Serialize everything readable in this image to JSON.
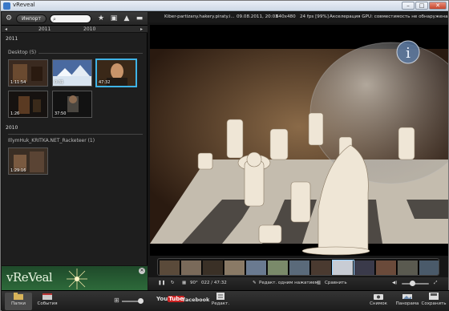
{
  "window": {
    "title": "vReveal",
    "buttons": [
      "–",
      "□",
      "✕"
    ]
  },
  "left_toolbar": {
    "import_label": "Импорт",
    "search_placeholder": ""
  },
  "timeline": {
    "prev": "◂",
    "years": [
      "2011",
      "2010"
    ],
    "next": "▸"
  },
  "library": {
    "year_2011": "2011",
    "folder1": {
      "name": "Desktop (5)",
      "items": [
        {
          "duration": "1:11:54"
        },
        {
          "duration": "0:31"
        },
        {
          "duration": "47:32"
        },
        {
          "duration": "1:26"
        },
        {
          "duration": "37:50"
        }
      ]
    },
    "year_2010": "2010",
    "folder2": {
      "name": "IllymHuk_KRITKA.NET_Racketeer (1)",
      "items": [
        {
          "duration": "1:29:16"
        }
      ]
    }
  },
  "logo": {
    "text": "vReVeal"
  },
  "info": {
    "filename": "Kiber-partizany.hakery.piraty.i...",
    "date": "09.08.2011, 20:03",
    "resolution": "640x480",
    "fps": "24 fps [99%]",
    "gpu": "Акселерация GPU: совместимость не обнаружена"
  },
  "controls": {
    "rotate_label": "90°",
    "time": "022 / 47:32",
    "edit_label": "Редакт. одним нажатием",
    "compare_label": "Сравнить"
  },
  "bottom": {
    "folders": "Папки",
    "events": "События",
    "youtube_you": "You",
    "youtube_tube": "Tube",
    "facebook": "facebook",
    "edit": "Редакт.",
    "snapshot": "Снимок",
    "panorama": "Панорама",
    "save": "Сохранить"
  },
  "colors": {
    "accent": "#3fb3e6",
    "logo_bg": "#2d6a3a"
  }
}
